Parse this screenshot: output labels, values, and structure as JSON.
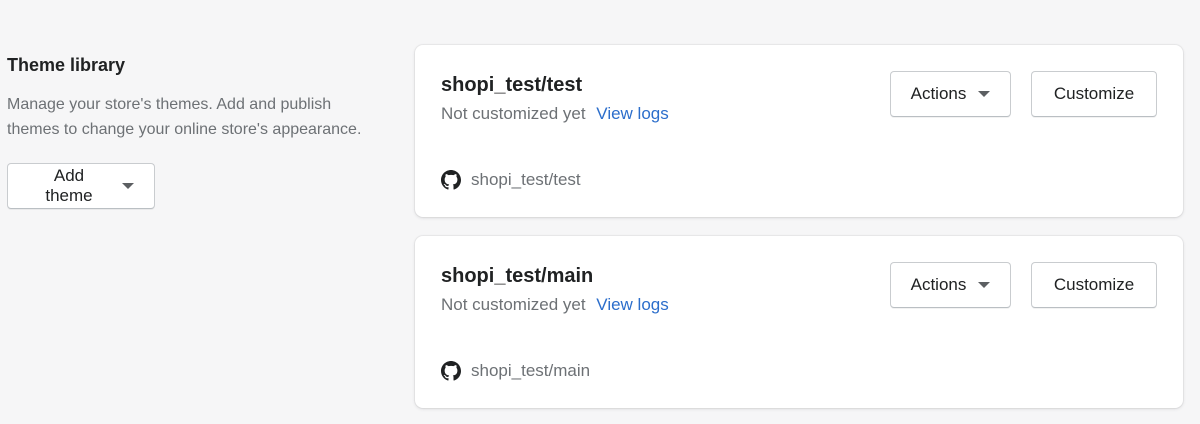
{
  "sidebar": {
    "title": "Theme library",
    "description": "Manage your store's themes. Add and publish themes to change your online store's appearance.",
    "add_theme_label": "Add theme"
  },
  "themes": [
    {
      "name": "shopi_test/test",
      "status": "Not customized yet",
      "logs_link": "View logs",
      "repo": "shopi_test/test",
      "actions_label": "Actions",
      "customize_label": "Customize"
    },
    {
      "name": "shopi_test/main",
      "status": "Not customized yet",
      "logs_link": "View logs",
      "repo": "shopi_test/main",
      "actions_label": "Actions",
      "customize_label": "Customize"
    }
  ],
  "icons": {
    "repo_icon": "github-icon",
    "dropdown_icon": "caret-down-icon"
  },
  "colors": {
    "link": "#2c6ecb",
    "subdued_text": "#6d7175",
    "background": "#f6f6f7"
  }
}
